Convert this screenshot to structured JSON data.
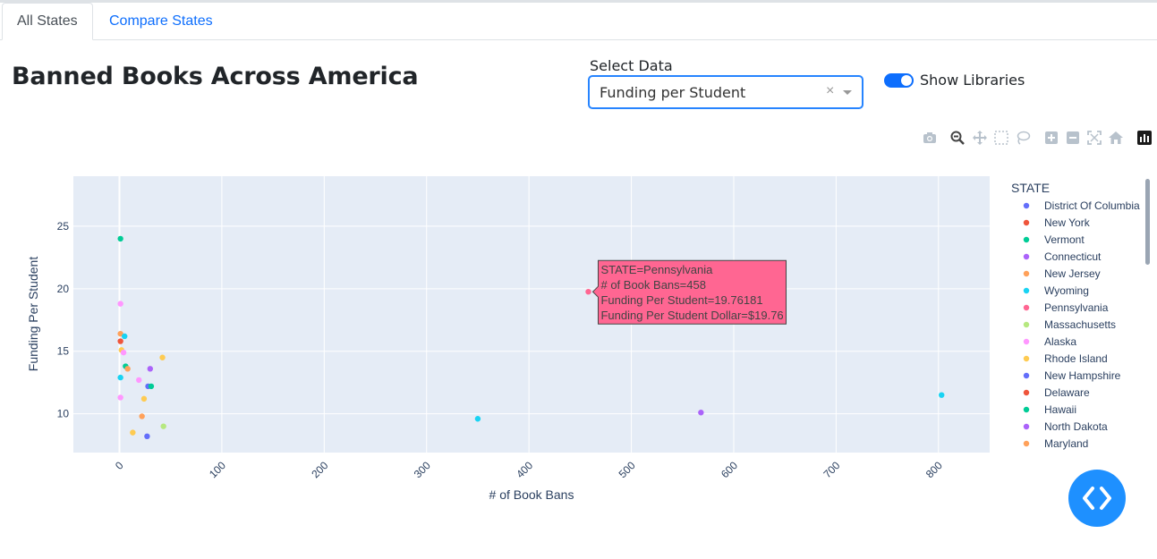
{
  "tabs": [
    {
      "label": "All States"
    },
    {
      "label": "Compare States"
    }
  ],
  "header": {
    "title": "Banned Books Across America"
  },
  "select": {
    "label": "Select Data",
    "value": "Funding per Student"
  },
  "toggle": {
    "label": "Show Libraries",
    "on": true
  },
  "colors": {
    "accent": "#0d6efd",
    "plot_bg": "#e5ecf6",
    "hover_bg": "#ff6692",
    "fab": "#1e90ff"
  },
  "modebar_icons": [
    "camera-icon",
    "zoom-icon",
    "pan-icon",
    "box-select-icon",
    "lasso-icon",
    "zoom-in-icon",
    "zoom-out-icon",
    "autoscale-icon",
    "reset-axes-icon",
    "plotly-logo-icon"
  ],
  "chart_data": {
    "type": "scatter",
    "xlabel": "# of Book Bans",
    "ylabel": "Funding Per Student",
    "xlim": [
      -45,
      850
    ],
    "ylim": [
      6.9,
      29
    ],
    "xticks": [
      0,
      100,
      200,
      300,
      400,
      500,
      600,
      700,
      800
    ],
    "yticks": [
      10,
      15,
      20,
      25
    ],
    "legend_title": "STATE",
    "legend": [
      {
        "name": "District Of Columbia",
        "color": "#636efa"
      },
      {
        "name": "New York",
        "color": "#ef553b"
      },
      {
        "name": "Vermont",
        "color": "#00cc96"
      },
      {
        "name": "Connecticut",
        "color": "#ab63fa"
      },
      {
        "name": "New Jersey",
        "color": "#ffa15a"
      },
      {
        "name": "Wyoming",
        "color": "#19d3f3"
      },
      {
        "name": "Pennsylvania",
        "color": "#ff6692"
      },
      {
        "name": "Massachusetts",
        "color": "#b6e880"
      },
      {
        "name": "Alaska",
        "color": "#ff97ff"
      },
      {
        "name": "Rhode Island",
        "color": "#fecb52"
      },
      {
        "name": "New Hampshire",
        "color": "#636efa"
      },
      {
        "name": "Delaware",
        "color": "#ef553b"
      },
      {
        "name": "Hawaii",
        "color": "#00cc96"
      },
      {
        "name": "North Dakota",
        "color": "#ab63fa"
      },
      {
        "name": "Maryland",
        "color": "#ffa15a"
      }
    ],
    "points": [
      {
        "x": 1,
        "y": 24.0,
        "color": "#00cc96"
      },
      {
        "x": 1,
        "y": 18.8,
        "color": "#ff97ff"
      },
      {
        "x": 1,
        "y": 16.4,
        "color": "#ffa15a"
      },
      {
        "x": 1,
        "y": 15.8,
        "color": "#ef553b"
      },
      {
        "x": 5,
        "y": 16.2,
        "color": "#19d3f3"
      },
      {
        "x": 2,
        "y": 15.1,
        "color": "#fecb52"
      },
      {
        "x": 4,
        "y": 14.9,
        "color": "#ff97ff"
      },
      {
        "x": 6,
        "y": 13.8,
        "color": "#00cc96"
      },
      {
        "x": 8,
        "y": 13.6,
        "color": "#ffa15a"
      },
      {
        "x": 30,
        "y": 13.6,
        "color": "#ab63fa"
      },
      {
        "x": 42,
        "y": 14.5,
        "color": "#fecb52"
      },
      {
        "x": 1,
        "y": 12.9,
        "color": "#19d3f3"
      },
      {
        "x": 19,
        "y": 12.7,
        "color": "#ff97ff"
      },
      {
        "x": 28,
        "y": 12.2,
        "color": "#636efa"
      },
      {
        "x": 31,
        "y": 12.2,
        "color": "#00cc96"
      },
      {
        "x": 1,
        "y": 11.3,
        "color": "#ff97ff"
      },
      {
        "x": 24,
        "y": 11.2,
        "color": "#fecb52"
      },
      {
        "x": 22,
        "y": 9.8,
        "color": "#ffa15a"
      },
      {
        "x": 43,
        "y": 9.0,
        "color": "#b6e880"
      },
      {
        "x": 13,
        "y": 8.5,
        "color": "#fecb52"
      },
      {
        "x": 27,
        "y": 8.2,
        "color": "#636efa"
      },
      {
        "x": 350,
        "y": 9.6,
        "color": "#19d3f3"
      },
      {
        "x": 568,
        "y": 10.1,
        "color": "#ab63fa"
      },
      {
        "x": 803,
        "y": 11.5,
        "color": "#19d3f3"
      },
      {
        "x": 458,
        "y": 19.76,
        "color": "#ff6692"
      }
    ],
    "hover": {
      "x": 458,
      "y": 19.76,
      "lines": [
        "STATE=Pennsylvania",
        "# of Book Bans=458",
        "Funding Per Student=19.76181",
        "Funding Per Student Dollar=$19.76"
      ]
    }
  }
}
